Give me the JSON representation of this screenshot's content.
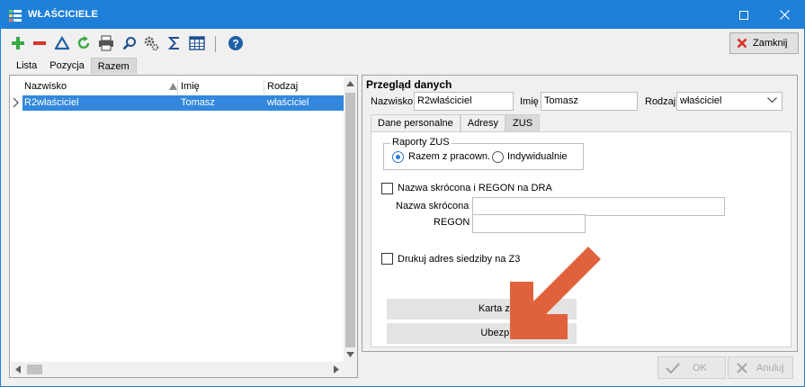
{
  "window": {
    "title": "WŁAŚCICIELE",
    "controls": {
      "maximize": "maximize-icon",
      "close": "close-icon"
    }
  },
  "toolbar": {
    "icons": [
      "add-icon",
      "remove-icon",
      "edit-icon",
      "refresh-icon",
      "print-icon",
      "search-icon",
      "settings-icon",
      "sum-icon",
      "columns-icon",
      "help-icon"
    ],
    "close_label": "Zamknij"
  },
  "main_tabs": [
    {
      "label": "Lista",
      "active": false
    },
    {
      "label": "Pozycja",
      "active": false
    },
    {
      "label": "Razem",
      "active": true
    }
  ],
  "grid": {
    "columns": [
      "Nazwisko",
      "Imię",
      "Rodzaj"
    ],
    "rows": [
      {
        "nazwisko": "R2właściciel",
        "imie": "Tomasz",
        "rodzaj": "właściciel",
        "selected": true
      }
    ]
  },
  "details": {
    "title": "Przegląd danych",
    "nazwisko_label": "Nazwisko",
    "nazwisko_value": "R2właściciel",
    "imie_label": "Imię",
    "imie_value": "Tomasz",
    "rodzaj_label": "Rodzaj",
    "rodzaj_value": "właściciel",
    "tabs": [
      {
        "label": "Dane personalne",
        "active": false
      },
      {
        "label": "Adresy",
        "active": false
      },
      {
        "label": "ZUS",
        "active": true
      }
    ],
    "zus": {
      "group_title": "Raporty ZUS",
      "radio_razem": "Razem z pracown.",
      "radio_indywidualnie": "Indywidualnie",
      "selected_radio": "Razem z pracown.",
      "checkbox_dra": "Nazwa skrócona i REGON na DRA",
      "nazwa_skrocona_label": "Nazwa skrócona",
      "nazwa_skrocona_value": "",
      "regon_label": "REGON",
      "regon_value": "",
      "checkbox_z3": "Drukuj adres siedziby na Z3",
      "karta_button": "Karta zasiłkowa",
      "ubezpieczenia_button": "Ubezpieczenia"
    }
  },
  "footer": {
    "ok_label": "OK",
    "cancel_label": "Anuluj"
  },
  "colors": {
    "titlebar": "#1e7fd8",
    "selection": "#3388dd",
    "annotation_arrow": "#e0623c"
  }
}
